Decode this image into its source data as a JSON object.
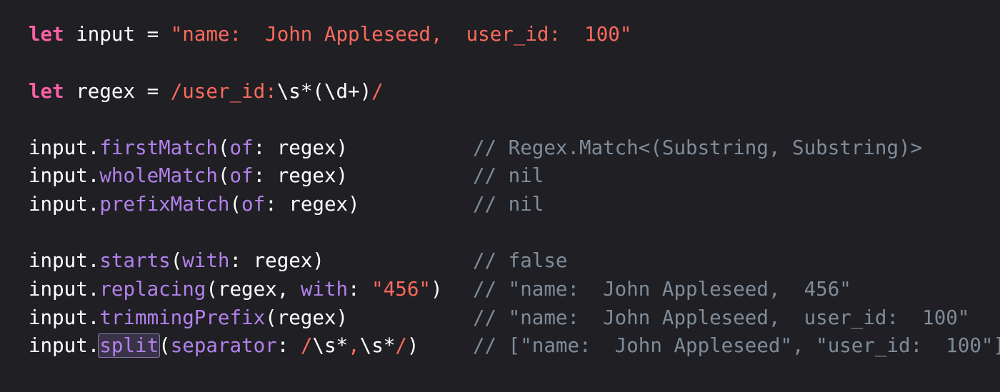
{
  "colors": {
    "background": "#1f1f24",
    "keyword": "#fc5fa3",
    "string": "#fc6a5d",
    "method": "#b281eb",
    "plain": "#ffffff",
    "comment": "#7f8c98"
  },
  "code": {
    "line1": {
      "kw": "let",
      "name": " input = ",
      "value": "\"name:  John Appleseed,  user_id:  100\""
    },
    "line2": {
      "kw": "let",
      "name": " regex = ",
      "regex_start": "/user_id:",
      "regex_mid": "\\s*(\\d+)",
      "regex_end": "/"
    },
    "line3": {
      "obj": "input.",
      "method": "firstMatch",
      "paren": "(",
      "label": "of",
      "args": ": regex)",
      "comment": "// Regex.Match<(Substring, Substring)>"
    },
    "line4": {
      "obj": "input.",
      "method": "wholeMatch",
      "paren": "(",
      "label": "of",
      "args": ": regex)",
      "comment": "// nil"
    },
    "line5": {
      "obj": "input.",
      "method": "prefixMatch",
      "paren": "(",
      "label": "of",
      "args": ": regex)",
      "comment": "// nil"
    },
    "line6": {
      "obj": "input.",
      "method": "starts",
      "paren": "(",
      "label": "with",
      "args": ": regex)",
      "comment": "// false"
    },
    "line7": {
      "obj": "input.",
      "method": "replacing",
      "args_pre": "(regex, ",
      "label": "with",
      "colon": ": ",
      "str": "\"456\"",
      "close": ")",
      "comment": "// \"name:  John Appleseed,  456\""
    },
    "line8": {
      "obj": "input.",
      "method": "trimmingPrefix",
      "args": "(regex)",
      "comment": "// \"name:  John Appleseed,  user_id:  100\""
    },
    "line9": {
      "obj": "input.",
      "method": "split",
      "paren": "(",
      "label": "separator",
      "colon": ": ",
      "rx1": "/",
      "rx2": "\\s*",
      "rx3": ",",
      "rx4": "\\s*",
      "rx5": "/",
      "close": ")",
      "comment": "// [\"name:  John Appleseed\", \"user_id:  100\"]"
    }
  }
}
